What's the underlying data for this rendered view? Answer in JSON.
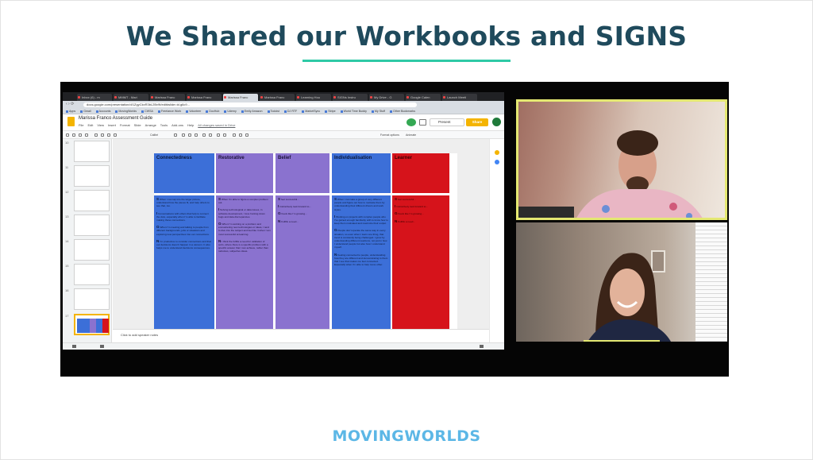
{
  "slide": {
    "title": "We Shared our Workbooks and SIGNS",
    "brand": "MOVINGWORLDS",
    "accent_color": "#2ec9a6",
    "title_color": "#1f4a5c",
    "brand_color": "#5cb7e6"
  },
  "browser": {
    "tabs": [
      "Inbox (6) - m",
      "MMMT - Mari",
      "Marissa Franc",
      "Marissa Franc",
      "Marissa Franc",
      "Marissa Franc",
      "Learning Hou",
      "SIGNs Instru",
      "My Drive - G",
      "Google Calen",
      "Launch Meeti"
    ],
    "url": "docs.google.com/presentation/d/1ZgyCkxR3bL2Bv9t/edit#slide=id.g6c9...",
    "bookmarks": [
      "Apps",
      "Gmail",
      "Accounts",
      "MovingWorlds",
      "CWSA",
      "Freelance Work",
      "Volunteer",
      "DocHub",
      "Udemy",
      "Emily Amazon",
      "Todoist",
      "DJ RTF",
      "MarketSync",
      "Stripe",
      "World Time Buddy",
      "My Stuff",
      "Other Bookmarks"
    ]
  },
  "docs": {
    "title": "Marissa Franco Assessment Guide",
    "menu": [
      "File",
      "Edit",
      "View",
      "Insert",
      "Format",
      "Slide",
      "Arrange",
      "Tools",
      "Add-ons",
      "Help"
    ],
    "saved_status": "All changes saved in Drive",
    "present_label": "Present",
    "share_label": "Share",
    "toolbar_font": "Calibri",
    "toolbar_options": [
      "Format options",
      "Animate"
    ],
    "speaker_notes": "Click to add speaker notes",
    "slide_numbers": [
      "10",
      "11",
      "12",
      "13",
      "14",
      "15",
      "16",
      "17"
    ]
  },
  "signs_table": {
    "columns": [
      {
        "header": "Connectedness",
        "body": [
          {
            "letter": "S",
            "text": "When I can tap into the larger picture, understand how the pieces fit, and help others to see that, too."
          },
          {
            "letter": "I",
            "text": "Conversations with others that help to connect the dots, especially when I'm able to facilitate making those connections."
          },
          {
            "letter": "G",
            "text": "When I'm meeting and talking to people from different backgrounds, jobs or situations and exploring new perspectives into our connections."
          },
          {
            "letter": "N",
            "text": "I'm productive to consider connections and that our decisions doesn't happen in a vacuum. It also helps me to understand decisions consequences."
          }
        ]
      },
      {
        "header": "Restorative",
        "body": [
          {
            "letter": "S",
            "text": "When I'm able to figure a complex problem out."
          },
          {
            "letter": "I",
            "text": "Solving technological or data issues, in software development, I love hunting down bugs and data discrepancies."
          },
          {
            "letter": "G",
            "text": "When I'm working on a problem and encountering new technologies or ideas, I tend to dive into the subject and feel like it when I am most successful at learning."
          },
          {
            "letter": "N",
            "text": "I think the fulfills a need for validation of sorts, where there is a specific problem with a specific answer that I can achieve, rather than nebulous, subjective ideas."
          }
        ]
      },
      {
        "header": "Belief",
        "body": [
          {
            "letter": "S",
            "text": "feel successful..."
          },
          {
            "letter": "I",
            "text": "Instinctively look forward to..."
          },
          {
            "letter": "G",
            "text": "Feels like I'm growing..."
          },
          {
            "letter": "N",
            "text": "Fulfills a need..."
          }
        ]
      },
      {
        "header": "Individualisation",
        "body": [
          {
            "letter": "S",
            "text": "When I can take a group of very different people and figure out how to motivate them by understanding their different drivers and work styles."
          },
          {
            "letter": "I",
            "text": "Working on projects with complex people who I've gained enough familiarity with to know how to keep them motivated and maximize their output."
          },
          {
            "letter": "G",
            "text": "People don't operate the same way in every situation, so even when I learn one thing, that trend is constantly being challenged. I grow by understanding different reactions, not just in how I understand people but also how I understand myself."
          },
          {
            "letter": "N",
            "text": "Feeling connected to people, understanding how they are different and demonstrating to them that I see that makes me feel connected. Especially when I'm able to help move other."
          }
        ]
      },
      {
        "header": "Learner",
        "body": [
          {
            "letter": "S",
            "text": "feel successful..."
          },
          {
            "letter": "I",
            "text": "Instinctively look forward to..."
          },
          {
            "letter": "G",
            "text": "Feels like I'm growing..."
          },
          {
            "letter": "N",
            "text": "Fulfills a need..."
          }
        ]
      }
    ],
    "colors": {
      "blue": "#3c6fd8",
      "purple": "#8a72cf",
      "red": "#d6131b"
    }
  },
  "video": {
    "active_speaker_color": "#e4e872",
    "participants": [
      "participant-1",
      "participant-2"
    ]
  }
}
